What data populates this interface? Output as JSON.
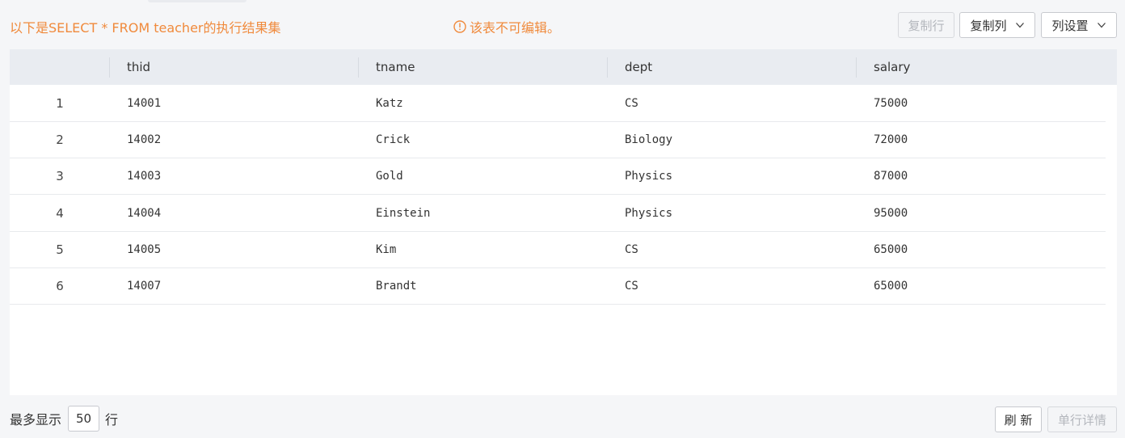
{
  "toolbar": {
    "title": "以下是SELECT * FROM teacher的执行结果集",
    "readonly_notice": "该表不可编辑。",
    "copy_row_label": "复制行",
    "copy_column_label": "复制列",
    "column_settings_label": "列设置"
  },
  "table": {
    "columns": [
      "thid",
      "tname",
      "dept",
      "salary"
    ],
    "rows": [
      {
        "index": "1",
        "thid": "14001",
        "tname": "Katz",
        "dept": "CS",
        "salary": "75000"
      },
      {
        "index": "2",
        "thid": "14002",
        "tname": "Crick",
        "dept": "Biology",
        "salary": "72000"
      },
      {
        "index": "3",
        "thid": "14003",
        "tname": "Gold",
        "dept": "Physics",
        "salary": "87000"
      },
      {
        "index": "4",
        "thid": "14004",
        "tname": "Einstein",
        "dept": "Physics",
        "salary": "95000"
      },
      {
        "index": "5",
        "thid": "14005",
        "tname": "Kim",
        "dept": "CS",
        "salary": "65000"
      },
      {
        "index": "6",
        "thid": "14007",
        "tname": "Brandt",
        "dept": "CS",
        "salary": "65000"
      }
    ]
  },
  "footer": {
    "max_display_prefix": "最多显示",
    "max_rows_value": "50",
    "max_display_suffix": "行",
    "refresh_label": "刷 新",
    "row_detail_label": "单行详情"
  },
  "colors": {
    "accent": "#f08a3c",
    "header_bg": "#e9ecf1",
    "disabled_text": "#b4b7bd"
  }
}
